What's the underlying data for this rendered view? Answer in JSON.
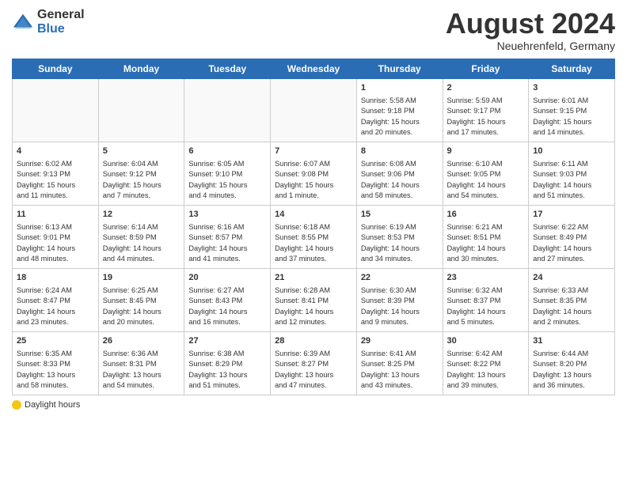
{
  "header": {
    "logo_general": "General",
    "logo_blue": "Blue",
    "month_title": "August 2024",
    "location": "Neuehrenfeld, Germany"
  },
  "weekdays": [
    "Sunday",
    "Monday",
    "Tuesday",
    "Wednesday",
    "Thursday",
    "Friday",
    "Saturday"
  ],
  "footer": {
    "label": "Daylight hours"
  },
  "weeks": [
    [
      {
        "day": "",
        "info": ""
      },
      {
        "day": "",
        "info": ""
      },
      {
        "day": "",
        "info": ""
      },
      {
        "day": "",
        "info": ""
      },
      {
        "day": "1",
        "info": "Sunrise: 5:58 AM\nSunset: 9:18 PM\nDaylight: 15 hours\nand 20 minutes."
      },
      {
        "day": "2",
        "info": "Sunrise: 5:59 AM\nSunset: 9:17 PM\nDaylight: 15 hours\nand 17 minutes."
      },
      {
        "day": "3",
        "info": "Sunrise: 6:01 AM\nSunset: 9:15 PM\nDaylight: 15 hours\nand 14 minutes."
      }
    ],
    [
      {
        "day": "4",
        "info": "Sunrise: 6:02 AM\nSunset: 9:13 PM\nDaylight: 15 hours\nand 11 minutes."
      },
      {
        "day": "5",
        "info": "Sunrise: 6:04 AM\nSunset: 9:12 PM\nDaylight: 15 hours\nand 7 minutes."
      },
      {
        "day": "6",
        "info": "Sunrise: 6:05 AM\nSunset: 9:10 PM\nDaylight: 15 hours\nand 4 minutes."
      },
      {
        "day": "7",
        "info": "Sunrise: 6:07 AM\nSunset: 9:08 PM\nDaylight: 15 hours\nand 1 minute."
      },
      {
        "day": "8",
        "info": "Sunrise: 6:08 AM\nSunset: 9:06 PM\nDaylight: 14 hours\nand 58 minutes."
      },
      {
        "day": "9",
        "info": "Sunrise: 6:10 AM\nSunset: 9:05 PM\nDaylight: 14 hours\nand 54 minutes."
      },
      {
        "day": "10",
        "info": "Sunrise: 6:11 AM\nSunset: 9:03 PM\nDaylight: 14 hours\nand 51 minutes."
      }
    ],
    [
      {
        "day": "11",
        "info": "Sunrise: 6:13 AM\nSunset: 9:01 PM\nDaylight: 14 hours\nand 48 minutes."
      },
      {
        "day": "12",
        "info": "Sunrise: 6:14 AM\nSunset: 8:59 PM\nDaylight: 14 hours\nand 44 minutes."
      },
      {
        "day": "13",
        "info": "Sunrise: 6:16 AM\nSunset: 8:57 PM\nDaylight: 14 hours\nand 41 minutes."
      },
      {
        "day": "14",
        "info": "Sunrise: 6:18 AM\nSunset: 8:55 PM\nDaylight: 14 hours\nand 37 minutes."
      },
      {
        "day": "15",
        "info": "Sunrise: 6:19 AM\nSunset: 8:53 PM\nDaylight: 14 hours\nand 34 minutes."
      },
      {
        "day": "16",
        "info": "Sunrise: 6:21 AM\nSunset: 8:51 PM\nDaylight: 14 hours\nand 30 minutes."
      },
      {
        "day": "17",
        "info": "Sunrise: 6:22 AM\nSunset: 8:49 PM\nDaylight: 14 hours\nand 27 minutes."
      }
    ],
    [
      {
        "day": "18",
        "info": "Sunrise: 6:24 AM\nSunset: 8:47 PM\nDaylight: 14 hours\nand 23 minutes."
      },
      {
        "day": "19",
        "info": "Sunrise: 6:25 AM\nSunset: 8:45 PM\nDaylight: 14 hours\nand 20 minutes."
      },
      {
        "day": "20",
        "info": "Sunrise: 6:27 AM\nSunset: 8:43 PM\nDaylight: 14 hours\nand 16 minutes."
      },
      {
        "day": "21",
        "info": "Sunrise: 6:28 AM\nSunset: 8:41 PM\nDaylight: 14 hours\nand 12 minutes."
      },
      {
        "day": "22",
        "info": "Sunrise: 6:30 AM\nSunset: 8:39 PM\nDaylight: 14 hours\nand 9 minutes."
      },
      {
        "day": "23",
        "info": "Sunrise: 6:32 AM\nSunset: 8:37 PM\nDaylight: 14 hours\nand 5 minutes."
      },
      {
        "day": "24",
        "info": "Sunrise: 6:33 AM\nSunset: 8:35 PM\nDaylight: 14 hours\nand 2 minutes."
      }
    ],
    [
      {
        "day": "25",
        "info": "Sunrise: 6:35 AM\nSunset: 8:33 PM\nDaylight: 13 hours\nand 58 minutes."
      },
      {
        "day": "26",
        "info": "Sunrise: 6:36 AM\nSunset: 8:31 PM\nDaylight: 13 hours\nand 54 minutes."
      },
      {
        "day": "27",
        "info": "Sunrise: 6:38 AM\nSunset: 8:29 PM\nDaylight: 13 hours\nand 51 minutes."
      },
      {
        "day": "28",
        "info": "Sunrise: 6:39 AM\nSunset: 8:27 PM\nDaylight: 13 hours\nand 47 minutes."
      },
      {
        "day": "29",
        "info": "Sunrise: 6:41 AM\nSunset: 8:25 PM\nDaylight: 13 hours\nand 43 minutes."
      },
      {
        "day": "30",
        "info": "Sunrise: 6:42 AM\nSunset: 8:22 PM\nDaylight: 13 hours\nand 39 minutes."
      },
      {
        "day": "31",
        "info": "Sunrise: 6:44 AM\nSunset: 8:20 PM\nDaylight: 13 hours\nand 36 minutes."
      }
    ]
  ]
}
